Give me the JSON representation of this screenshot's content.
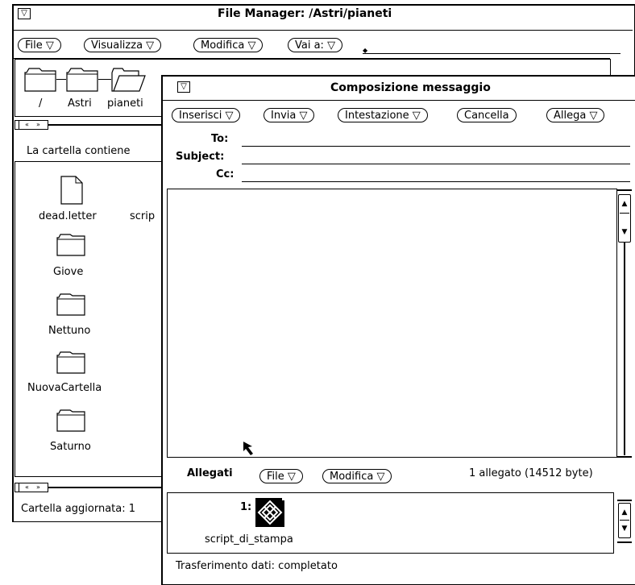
{
  "file_manager": {
    "title": "File Manager: /Astri/pianeti",
    "menu": {
      "file": "File ▽",
      "view": "Visualizza ▽",
      "edit": "Modifica ▽",
      "goto": "Vai a: ▽"
    },
    "path": [
      "/",
      "Astri",
      "pianeti"
    ],
    "folder_info": "La cartella contiene",
    "files": [
      {
        "name": "dead.letter",
        "icon": "document-icon"
      },
      {
        "name": "scrip",
        "icon": "document-icon"
      },
      {
        "name": "Giove",
        "icon": "folder-icon"
      },
      {
        "name": "Nettuno",
        "icon": "folder-icon"
      },
      {
        "name": "NuovaCartella",
        "icon": "folder-icon"
      },
      {
        "name": "Saturno",
        "icon": "folder-icon"
      }
    ],
    "status": "Cartella aggiornata:  1"
  },
  "compose": {
    "title": "Composizione messaggio",
    "menu": {
      "insert": "Inserisci ▽",
      "send": "Invia ▽",
      "header": "Intestazione ▽",
      "clear": "Cancella",
      "attach": "Allega ▽"
    },
    "fields": {
      "to": "To:",
      "subject": "Subject:",
      "cc": "Cc:"
    },
    "attachments": {
      "label": "Allegati",
      "file_menu": "File ▽",
      "edit_menu": "Modifica ▽",
      "summary": "1 allegato (14512 byte)",
      "items": [
        {
          "index": "1:",
          "name": "script_di_stampa"
        }
      ]
    },
    "status": "Trasferimento dati: completato"
  }
}
